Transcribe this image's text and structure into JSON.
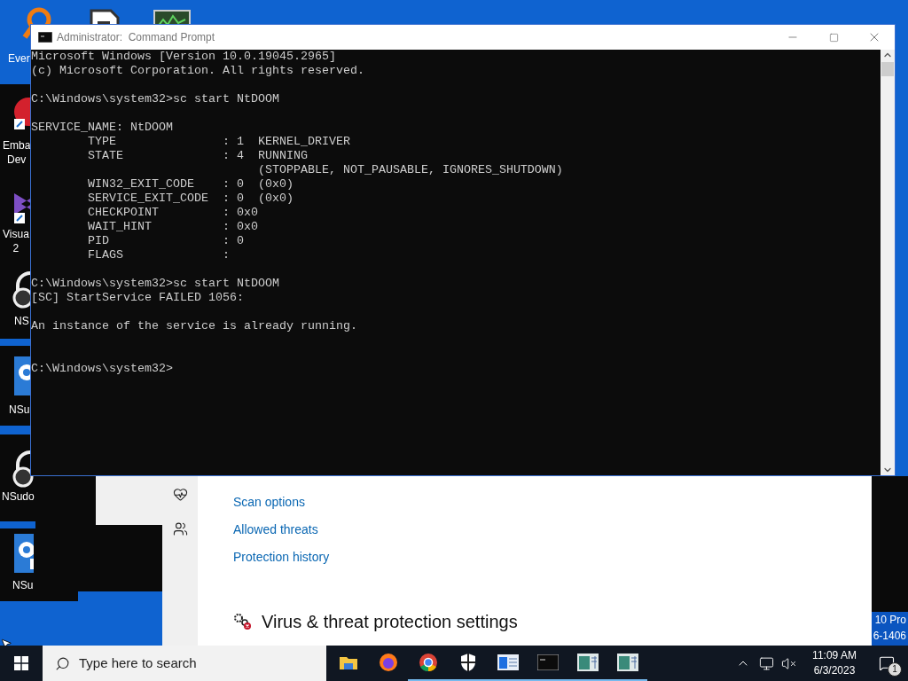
{
  "desktop_icons": [
    {
      "kind": "magnifier",
      "labels": [
        "Ever"
      ]
    },
    {
      "kind": "document"
    },
    {
      "kind": "monitor"
    },
    {
      "kind": "red-circle",
      "labels": [
        "Emba",
        "Dev"
      ]
    },
    {
      "kind": "bowtie",
      "labels": [
        "Visua",
        "2"
      ]
    },
    {
      "kind": "headphones",
      "labels": [
        "NS"
      ]
    },
    {
      "kind": "gear",
      "labels": [
        "NSu"
      ]
    },
    {
      "kind": "headphones",
      "labels": [
        "NSudo"
      ]
    },
    {
      "kind": "gear",
      "labels": [
        "NSu"
      ]
    }
  ],
  "desktop_watermark": [
    "10 Pro",
    "6-1406"
  ],
  "security_window": {
    "links": [
      "Scan options",
      "Allowed threats",
      "Protection history"
    ],
    "heading": "Virus & threat protection settings"
  },
  "console_window": {
    "title": "Administrator:  Command Prompt",
    "lines": [
      {
        "kind": "text",
        "text": "Microsoft Windows [Version 10.0.19045.2965]"
      },
      {
        "kind": "text",
        "text": "(c) Microsoft Corporation. All rights reserved."
      },
      {
        "kind": "blank"
      },
      {
        "kind": "text",
        "text": "C:\\Windows\\system32>sc start NtDOOM"
      },
      {
        "kind": "blank"
      },
      {
        "kind": "text",
        "text": "SERVICE_NAME: NtDOOM"
      },
      {
        "kind": "text",
        "text": "        TYPE               : 1  KERNEL_DRIVER"
      },
      {
        "kind": "text",
        "text": "        STATE              : 4  RUNNING"
      },
      {
        "kind": "text",
        "text": "                                (STOPPABLE, NOT_PAUSABLE, IGNORES_SHUTDOWN)"
      },
      {
        "kind": "text",
        "text": "        WIN32_EXIT_CODE    : 0  (0x0)"
      },
      {
        "kind": "text",
        "text": "        SERVICE_EXIT_CODE  : 0  (0x0)"
      },
      {
        "kind": "text",
        "text": "        CHECKPOINT         : 0x0"
      },
      {
        "kind": "text",
        "text": "        WAIT_HINT          : 0x0"
      },
      {
        "kind": "text",
        "text": "        PID                : 0"
      },
      {
        "kind": "text",
        "text": "        FLAGS              :"
      },
      {
        "kind": "blank"
      },
      {
        "kind": "text",
        "text": "C:\\Windows\\system32>sc start NtDOOM"
      },
      {
        "kind": "text",
        "text": "[SC] StartService FAILED 1056:"
      },
      {
        "kind": "blank"
      },
      {
        "kind": "text",
        "text": "An instance of the service is already running."
      },
      {
        "kind": "blank"
      },
      {
        "kind": "blank"
      },
      {
        "kind": "text",
        "text": "C:\\Windows\\system32>"
      }
    ]
  },
  "taskbar": {
    "search": {
      "placeholder": "Type here to search"
    },
    "apps": [
      {
        "kind": "folder",
        "running": false
      },
      {
        "kind": "firefox",
        "running": false
      },
      {
        "kind": "chrome",
        "running": true
      },
      {
        "kind": "shield",
        "running": true
      },
      {
        "kind": "panel",
        "running": true
      },
      {
        "kind": "console",
        "running": true
      },
      {
        "kind": "window",
        "running": true
      },
      {
        "kind": "window",
        "running": true
      }
    ],
    "clock": {
      "time": "11:09 AM",
      "date": "6/3/2023"
    },
    "notifications": {
      "count": "1"
    }
  }
}
